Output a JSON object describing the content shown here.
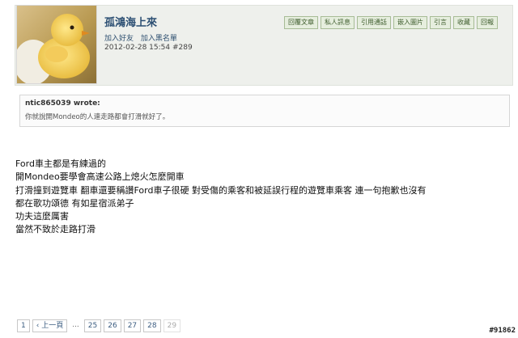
{
  "user": {
    "name": "孤鴻海上來",
    "links": [
      "加入好友",
      "加入黑名單"
    ],
    "timestamp": "2012-02-28 15:54",
    "post_number": "#289"
  },
  "actions": [
    "回覆文章",
    "私人訊息",
    "引用通話",
    "嵌入圖片",
    "引言",
    "收藏",
    "回報"
  ],
  "quote": {
    "author": "ntic865039 wrote:",
    "text": "你就說開Mondeo的人連走路都會打滑就好了。"
  },
  "body": [
    "Ford車主都是有練過的",
    "開Mondeo要學會高速公路上熄火怎麼開車",
    "打滑撞到遊覽車 翻車還要稱讚Ford車子很硬 對受傷的乘客和被延誤行程的遊覽車乘客 連一句抱歉也沒有",
    "都在歌功頌德 有如星宿派弟子",
    "功夫這麼厲害",
    "當然不致於走路打滑"
  ],
  "pagination": [
    "1",
    "‹ 上一頁",
    "...",
    "25",
    "26",
    "27",
    "28",
    "29"
  ],
  "watermark": "#91862",
  "colors": {
    "header_bg": "#eef0ec",
    "username": "#2c4f73",
    "button_border": "#a7bc96"
  }
}
